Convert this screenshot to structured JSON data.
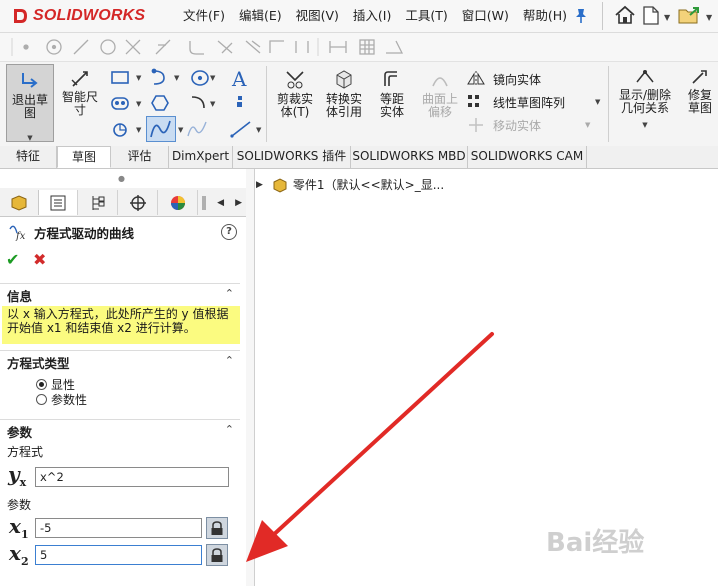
{
  "app": {
    "logo_text": "SOLIDWORKS"
  },
  "menu": [
    {
      "label": "文件(F)"
    },
    {
      "label": "编辑(E)"
    },
    {
      "label": "视图(V)"
    },
    {
      "label": "插入(I)"
    },
    {
      "label": "工具(T)"
    },
    {
      "label": "窗口(W)"
    },
    {
      "label": "帮助(H)"
    }
  ],
  "commands": {
    "exit_sketch": "退出草图",
    "smart_dimension": "智能尺寸",
    "trim_entities": "剪裁实体(T)",
    "convert_entities": "转换实体引用",
    "offset_entities": "等距实体",
    "offset_on_surface": "曲面上偏移",
    "mirror_entities": "镜向实体",
    "linear_pattern": "线性草图阵列",
    "move_entities": "移动实体",
    "display_relations": "显示/删除几何关系",
    "repair_sketch": "修复草图"
  },
  "tabs": [
    {
      "label": "特征"
    },
    {
      "label": "草图"
    },
    {
      "label": "评估"
    },
    {
      "label": "DimXpert"
    },
    {
      "label": "SOLIDWORKS 插件"
    },
    {
      "label": "SOLIDWORKS MBD"
    },
    {
      "label": "SOLIDWORKS CAM"
    }
  ],
  "property_manager": {
    "title": "方程式驱动的曲线",
    "info": {
      "header": "信息",
      "text_line1": "以 x 输入方程式，此处所产生的 y 值根据",
      "text_line2": "开始值 x1 和结束值 x2 进行计算。"
    },
    "equation_type": {
      "header": "方程式类型",
      "options": [
        {
          "label": "显性",
          "selected": true
        },
        {
          "label": "参数性",
          "selected": false
        }
      ]
    },
    "parameters": {
      "header": "参数",
      "equation_label": "方程式",
      "equation_var": "y",
      "equation_sub": "x",
      "equation_value": "x^2",
      "params_label": "参数",
      "var": "x",
      "x1_sub": "1",
      "x1_value": "-5",
      "x2_sub": "2",
      "x2_value": "5"
    }
  },
  "feature_tree": {
    "root_label": "零件1（默认<<默认>_显..."
  },
  "watermark": {
    "text": "Bai经验"
  },
  "colors": {
    "brand_red": "#d42727",
    "info_yellow": "#fbfb80",
    "ok_green": "#1c9b23",
    "cancel_red": "#d22b2b",
    "arrow_red": "#e12a26"
  }
}
